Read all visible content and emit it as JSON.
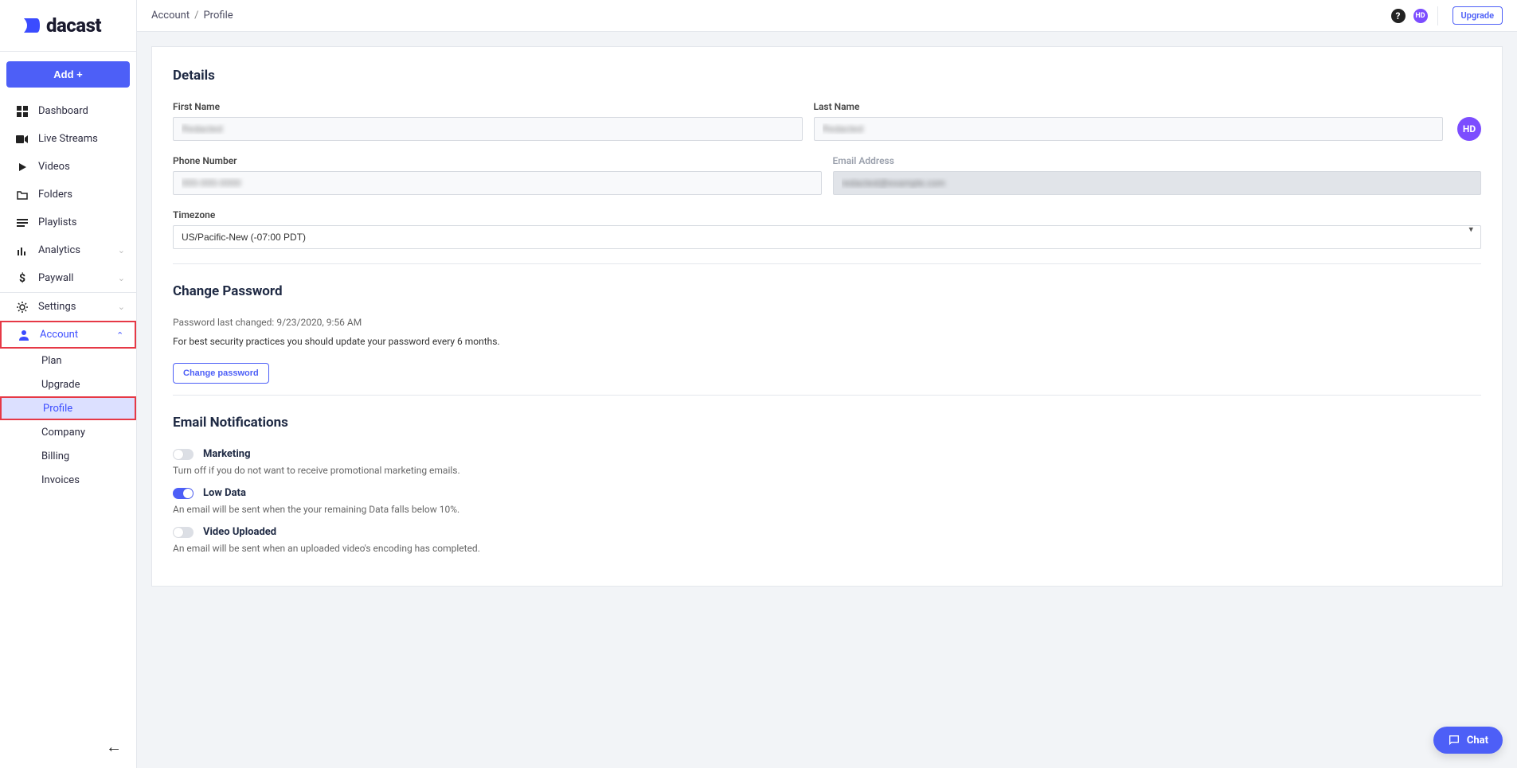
{
  "brand": "dacast",
  "add_button": "Add +",
  "sidebar": {
    "items": [
      {
        "label": "Dashboard",
        "icon": "dashboard"
      },
      {
        "label": "Live Streams",
        "icon": "camera"
      },
      {
        "label": "Videos",
        "icon": "play"
      },
      {
        "label": "Folders",
        "icon": "folder"
      },
      {
        "label": "Playlists",
        "icon": "list"
      },
      {
        "label": "Analytics",
        "icon": "bars",
        "expandable": true
      },
      {
        "label": "Paywall",
        "icon": "dollar",
        "expandable": true
      }
    ],
    "items2": [
      {
        "label": "Settings",
        "icon": "gear",
        "expandable": true
      },
      {
        "label": "Account",
        "icon": "person",
        "expandable": true,
        "active": true,
        "highlight": true
      }
    ],
    "account_sub": [
      {
        "label": "Plan"
      },
      {
        "label": "Upgrade"
      },
      {
        "label": "Profile",
        "active": true,
        "highlight": true
      },
      {
        "label": "Company"
      },
      {
        "label": "Billing"
      },
      {
        "label": "Invoices"
      }
    ]
  },
  "breadcrumb": {
    "root": "Account",
    "page": "Profile"
  },
  "topbar": {
    "upgrade": "Upgrade",
    "avatar": "HD"
  },
  "details": {
    "title": "Details",
    "first_name_label": "First Name",
    "first_name_value": "Redacted",
    "last_name_label": "Last Name",
    "last_name_value": "Redacted",
    "phone_label": "Phone Number",
    "phone_value": "000-000-0000",
    "email_label": "Email Address",
    "email_value": "redacted@example.com",
    "timezone_label": "Timezone",
    "timezone_value": "US/Pacific-New (-07:00 PDT)",
    "avatar": "HD"
  },
  "password": {
    "title": "Change Password",
    "last_changed": "Password last changed: 9/23/2020, 9:56 AM",
    "advice": "For best security practices you should update your password every 6 months.",
    "button": "Change password"
  },
  "notifications": {
    "title": "Email Notifications",
    "items": [
      {
        "label": "Marketing",
        "desc": "Turn off if you do not want to receive promotional marketing emails.",
        "on": false
      },
      {
        "label": "Low Data",
        "desc": "An email will be sent when the your remaining Data falls below 10%.",
        "on": true
      },
      {
        "label": "Video Uploaded",
        "desc": "An email will be sent when an uploaded video's encoding has completed.",
        "on": false
      }
    ]
  },
  "chat": "Chat"
}
